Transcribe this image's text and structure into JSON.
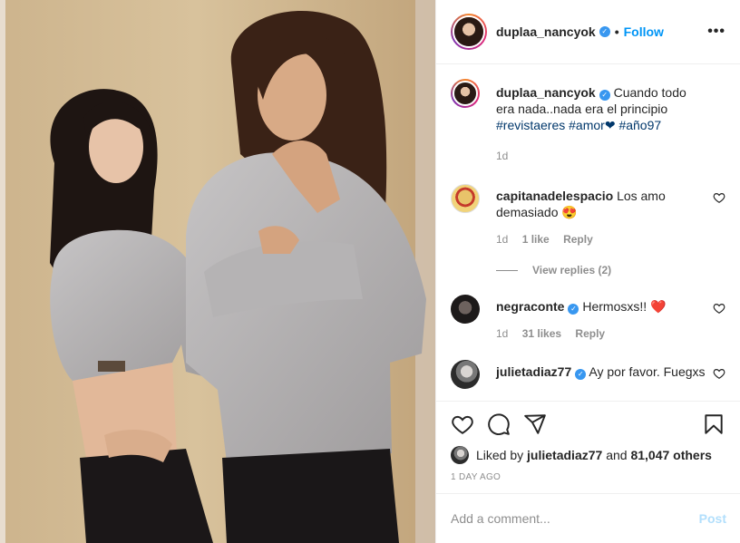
{
  "post": {
    "author": "duplaa_nancyok",
    "follow_label": "Follow",
    "more_label": "•••",
    "dot": "•",
    "verified_mark": "✓"
  },
  "caption": {
    "author": "duplaa_nancyok",
    "text": "Cuando todo era nada..nada era el principio",
    "hashtags": "#revistaeres #amor❤ #año97",
    "time": "1d"
  },
  "comments": [
    {
      "author": "capitanadelespacio",
      "text": "Los amo demasiado 😍",
      "time": "1d",
      "likes": "1 like",
      "reply": "Reply",
      "verified": false
    },
    {
      "author": "negraconte",
      "text": "Hermosxs!! ❤️",
      "time": "1d",
      "likes": "31 likes",
      "reply": "Reply",
      "verified": true
    },
    {
      "author": "julietadiaz77",
      "text": "Ay por favor. Fuegxs",
      "verified": true
    }
  ],
  "view_replies": "View replies (2)",
  "likes": {
    "prefix": "Liked by ",
    "user": "julietadiaz77",
    "middle": " and ",
    "count": "81,047 others"
  },
  "date": "1 DAY AGO",
  "add_comment": {
    "placeholder": "Add a comment...",
    "post_label": "Post"
  },
  "icons": {
    "like": "heart-icon",
    "comment": "comment-icon",
    "share": "share-icon",
    "save": "bookmark-icon",
    "more": "more-options-icon"
  },
  "colors": {
    "link": "#0095f6",
    "hashtag": "#00376b",
    "muted": "#8e8e8e",
    "verified": "#3897f0",
    "heart": "#ed4956"
  }
}
